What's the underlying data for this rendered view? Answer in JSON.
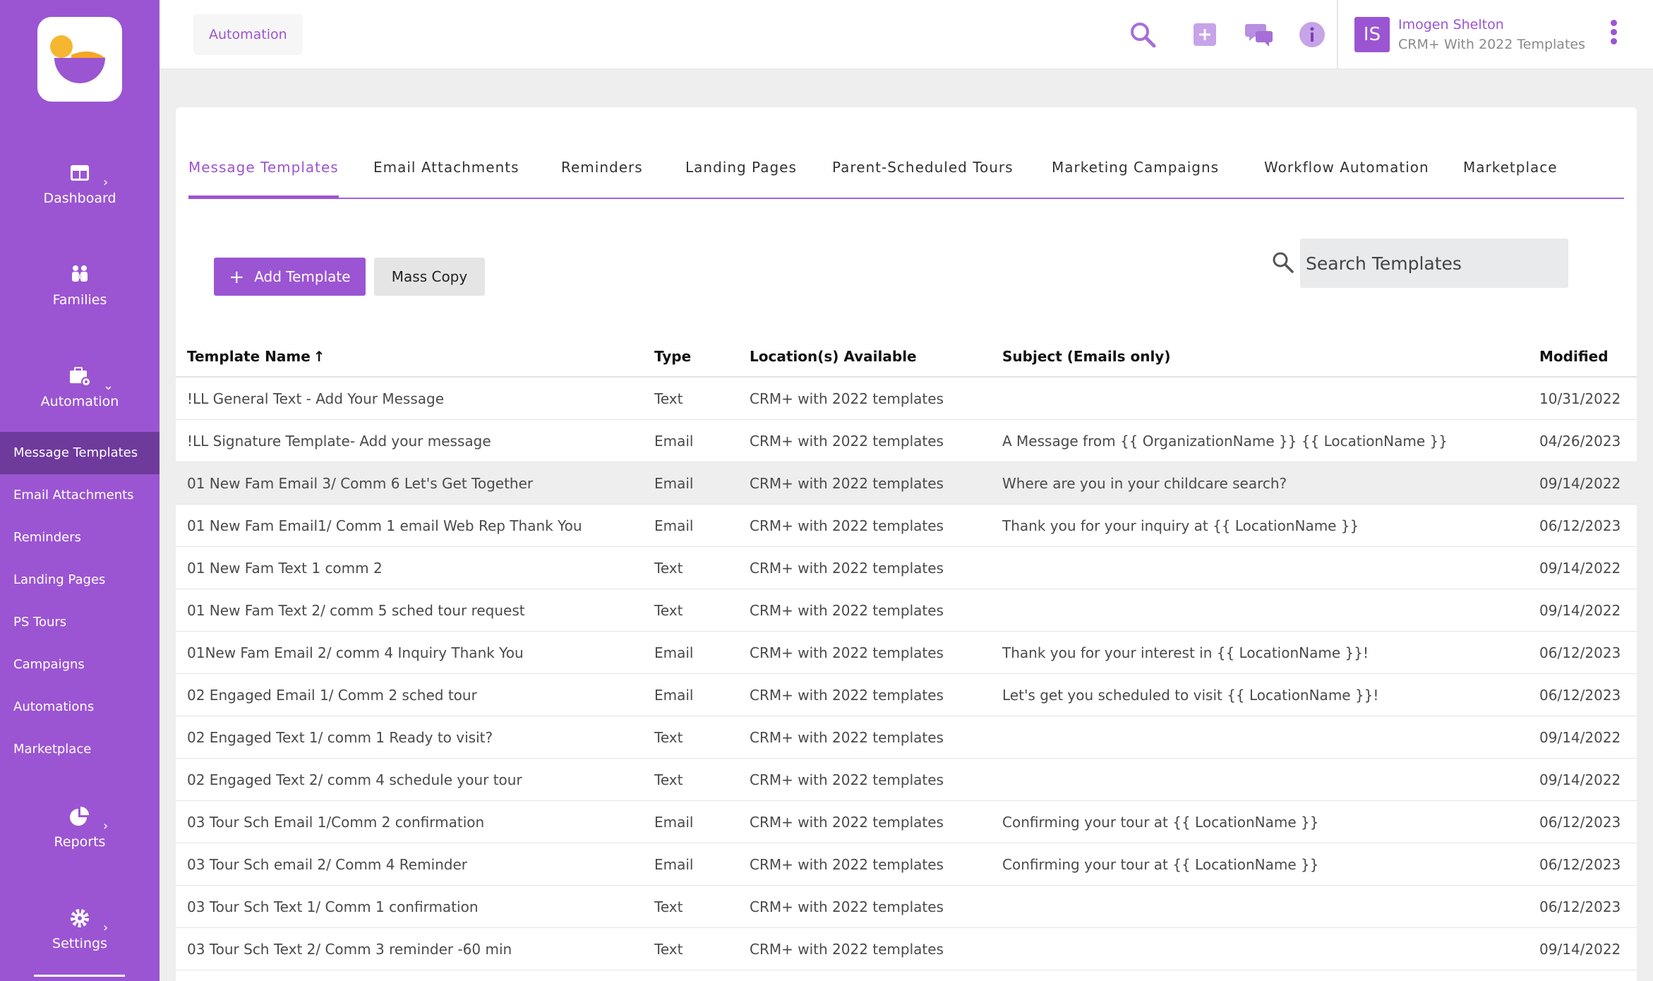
{
  "sidebar": {
    "main_items": [
      {
        "label": "Dashboard",
        "icon": "dashboard-icon"
      },
      {
        "label": "Families",
        "icon": "families-icon"
      },
      {
        "label": "Automation",
        "icon": "automation-icon"
      },
      {
        "label": "Reports",
        "icon": "reports-pie-icon"
      },
      {
        "label": "Settings",
        "icon": "gear-icon"
      }
    ],
    "sub_items": [
      {
        "label": "Message Templates",
        "active": true
      },
      {
        "label": "Email Attachments"
      },
      {
        "label": "Reminders"
      },
      {
        "label": "Landing Pages"
      },
      {
        "label": "PS Tours"
      },
      {
        "label": "Campaigns"
      },
      {
        "label": "Automations"
      },
      {
        "label": "Marketplace"
      }
    ]
  },
  "header": {
    "breadcrumb": "Automation",
    "icons": [
      "search-icon",
      "plus-icon",
      "chat-icon",
      "info-icon"
    ],
    "user": {
      "initials": "IS",
      "name": "Imogen Shelton",
      "org": "CRM+ With 2022 Templates"
    }
  },
  "tabs": [
    {
      "label": "Message Templates",
      "active": true
    },
    {
      "label": "Email Attachments"
    },
    {
      "label": "Reminders"
    },
    {
      "label": "Landing Pages"
    },
    {
      "label": "Parent-Scheduled Tours"
    },
    {
      "label": "Marketing Campaigns"
    },
    {
      "label": "Workflow Automation"
    },
    {
      "label": "Marketplace"
    }
  ],
  "toolbar": {
    "add_label": "Add Template",
    "copy_label": "Mass Copy",
    "search_placeholder": "Search Templates"
  },
  "table": {
    "columns": [
      "Template Name",
      "Type",
      "Location(s) Available",
      "Subject (Emails only)",
      "Modified"
    ],
    "sort_indicator": "↑",
    "rows": [
      {
        "name": "!LL General Text - Add Your Message",
        "type": "Text",
        "location": "CRM+ with 2022 templates",
        "subject": "",
        "modified": "10/31/2022"
      },
      {
        "name": "!LL Signature Template- Add your message",
        "type": "Email",
        "location": "CRM+ with 2022 templates",
        "subject": "A Message from {{ OrganizationName }} {{ LocationName }}",
        "modified": "04/26/2023"
      },
      {
        "name": "01 New Fam Email 3/ Comm 6 Let's Get Together",
        "type": "Email",
        "location": "CRM+ with 2022 templates",
        "subject": "Where are you in your childcare search?",
        "modified": "09/14/2022"
      },
      {
        "name": "01 New Fam Email1/ Comm 1 email Web Rep Thank You",
        "type": "Email",
        "location": "CRM+ with 2022 templates",
        "subject": "Thank you for your inquiry at {{ LocationName }}",
        "modified": "06/12/2023"
      },
      {
        "name": "01 New Fam Text 1 comm 2",
        "type": "Text",
        "location": "CRM+ with 2022 templates",
        "subject": "",
        "modified": "09/14/2022"
      },
      {
        "name": "01 New Fam Text 2/ comm 5 sched tour request",
        "type": "Text",
        "location": "CRM+ with 2022 templates",
        "subject": "",
        "modified": "09/14/2022"
      },
      {
        "name": "01New Fam Email 2/ comm 4 Inquiry Thank You",
        "type": "Email",
        "location": "CRM+ with 2022 templates",
        "subject": "Thank you for your interest in {{ LocationName }}!",
        "modified": "06/12/2023"
      },
      {
        "name": "02 Engaged Email 1/ Comm 2 sched tour",
        "type": "Email",
        "location": "CRM+ with 2022 templates",
        "subject": "Let's get you scheduled to visit {{ LocationName }}!",
        "modified": "06/12/2023"
      },
      {
        "name": "02 Engaged Text 1/ comm 1 Ready to visit?",
        "type": "Text",
        "location": "CRM+ with 2022 templates",
        "subject": "",
        "modified": "09/14/2022"
      },
      {
        "name": "02 Engaged Text 2/ comm 4 schedule your tour",
        "type": "Text",
        "location": "CRM+ with 2022 templates",
        "subject": "",
        "modified": "09/14/2022"
      },
      {
        "name": "03 Tour Sch Email 1/Comm 2 confirmation",
        "type": "Email",
        "location": "CRM+ with 2022 templates",
        "subject": "Confirming your tour at {{ LocationName }}",
        "modified": "06/12/2023"
      },
      {
        "name": "03 Tour Sch email 2/ Comm 4 Reminder",
        "type": "Email",
        "location": "CRM+ with 2022 templates",
        "subject": "Confirming your tour at {{ LocationName }}",
        "modified": "06/12/2023"
      },
      {
        "name": "03 Tour Sch Text 1/ Comm 1 confirmation",
        "type": "Text",
        "location": "CRM+ with 2022 templates",
        "subject": "",
        "modified": "06/12/2023"
      },
      {
        "name": "03 Tour Sch Text 2/ Comm 3 reminder -60 min",
        "type": "Text",
        "location": "CRM+ with 2022 templates",
        "subject": "",
        "modified": "09/14/2022"
      }
    ]
  },
  "colors": {
    "brand": "#9b55d2",
    "sidebar_active": "#6e3a9c",
    "logo_yellow": "#f5b731"
  }
}
